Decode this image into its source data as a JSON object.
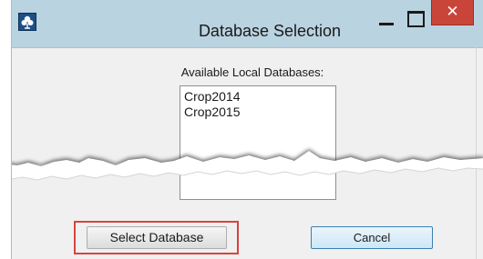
{
  "window": {
    "title": "Database Selection",
    "close_glyph": "✕",
    "icon": "cotton-boll-icon"
  },
  "list": {
    "label": "Available Local Databases:",
    "items": [
      "Crop2014",
      "Crop2015"
    ]
  },
  "buttons": {
    "select_label": "Select Database",
    "cancel_label": "Cancel"
  },
  "colors": {
    "titlebar": "#b9d3e0",
    "close_button": "#c9453a",
    "highlight": "#d9433f",
    "window_bg": "#f0f0f0"
  }
}
